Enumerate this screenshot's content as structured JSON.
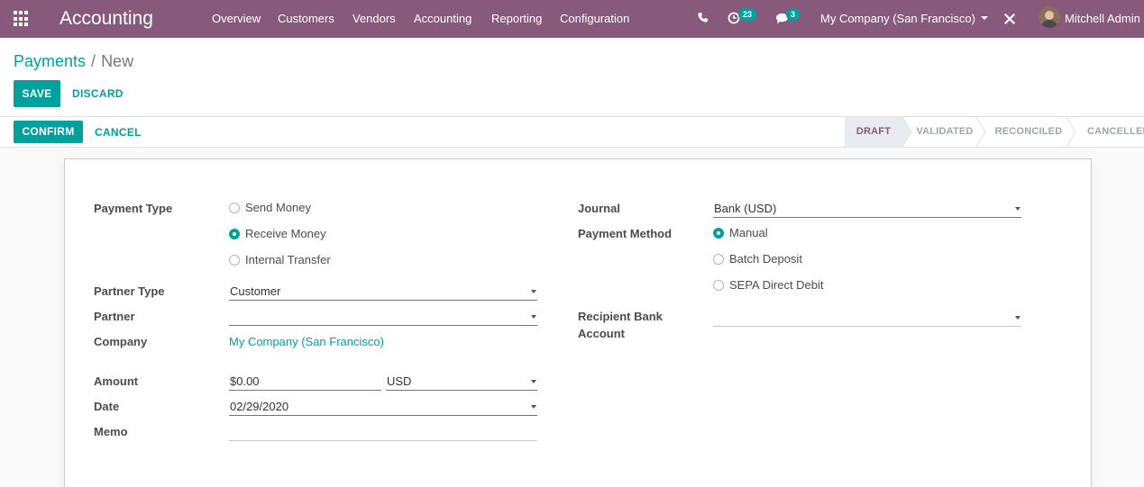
{
  "app": {
    "brand": "Accounting",
    "menu": [
      "Overview",
      "Customers",
      "Vendors",
      "Accounting",
      "Reporting",
      "Configuration"
    ],
    "activity_count": "23",
    "message_count": "3",
    "company": "My Company (San Francisco)",
    "user": "Mitchell Admin"
  },
  "breadcrumb": {
    "parent": "Payments",
    "separator": "/",
    "current": "New"
  },
  "actions": {
    "save": "SAVE",
    "discard": "DISCARD",
    "confirm": "CONFIRM",
    "cancel": "CANCEL"
  },
  "stages": [
    {
      "label": "DRAFT",
      "active": true
    },
    {
      "label": "VALIDATED",
      "active": false
    },
    {
      "label": "RECONCILED",
      "active": false
    },
    {
      "label": "CANCELLED",
      "active": false
    }
  ],
  "form": {
    "payment_type": {
      "label": "Payment Type",
      "options": [
        {
          "label": "Send Money",
          "selected": false
        },
        {
          "label": "Receive Money",
          "selected": true
        },
        {
          "label": "Internal Transfer",
          "selected": false
        }
      ]
    },
    "partner_type": {
      "label": "Partner Type",
      "value": "Customer"
    },
    "partner": {
      "label": "Partner",
      "value": ""
    },
    "company": {
      "label": "Company",
      "value": "My Company (San Francisco)"
    },
    "amount": {
      "label": "Amount",
      "value": "$0.00",
      "currency": "USD"
    },
    "date": {
      "label": "Date",
      "value": "02/29/2020"
    },
    "memo": {
      "label": "Memo",
      "value": ""
    },
    "journal": {
      "label": "Journal",
      "value": "Bank (USD)"
    },
    "payment_method": {
      "label": "Payment Method",
      "options": [
        {
          "label": "Manual",
          "selected": true
        },
        {
          "label": "Batch Deposit",
          "selected": false
        },
        {
          "label": "SEPA Direct Debit",
          "selected": false
        }
      ]
    },
    "recipient_bank": {
      "label_line1": "Recipient Bank",
      "label_line2": "Account",
      "value": ""
    }
  },
  "colors": {
    "navbar": "#875a7b",
    "accent": "#00a09d"
  }
}
